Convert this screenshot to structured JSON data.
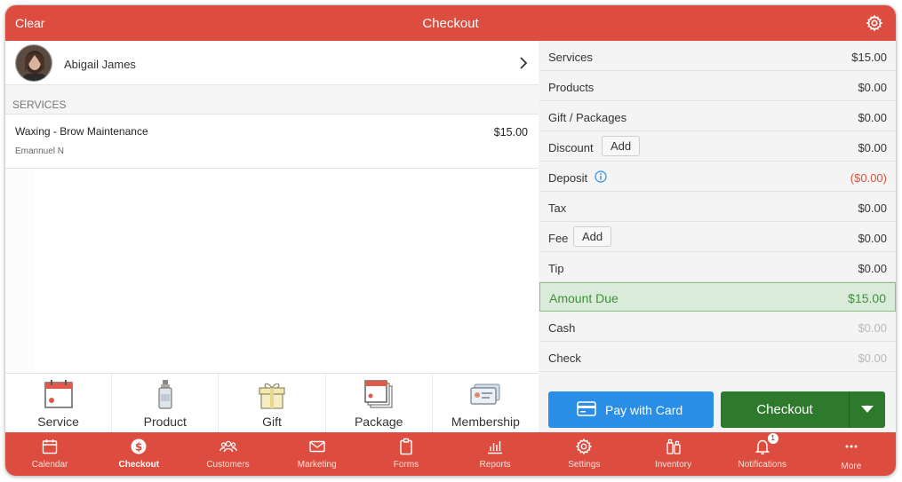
{
  "header": {
    "clear_label": "Clear",
    "title": "Checkout",
    "settings_icon": "gear-icon"
  },
  "client": {
    "name": "Abigail James"
  },
  "services_section": {
    "heading": "SERVICES",
    "items": [
      {
        "name": "Waxing - Brow Maintenance",
        "staff": "Emannuel N",
        "price": "$15.00"
      }
    ]
  },
  "quick_add": [
    {
      "label": "Service",
      "icon": "calendar-icon"
    },
    {
      "label": "Product",
      "icon": "bottle-icon"
    },
    {
      "label": "Gift",
      "icon": "gift-icon"
    },
    {
      "label": "Package",
      "icon": "calendar-stack-icon"
    },
    {
      "label": "Membership",
      "icon": "membership-card-icon"
    }
  ],
  "summary": {
    "services": {
      "label": "Services",
      "value": "$15.00"
    },
    "products": {
      "label": "Products",
      "value": "$0.00"
    },
    "gift_packages": {
      "label": "Gift / Packages",
      "value": "$0.00"
    },
    "discount": {
      "label": "Discount",
      "add_label": "Add",
      "value": "$0.00"
    },
    "deposit": {
      "label": "Deposit",
      "value": "($0.00)"
    },
    "tax": {
      "label": "Tax",
      "value": "$0.00"
    },
    "fee": {
      "label": "Fee",
      "add_label": "Add",
      "value": "$0.00"
    },
    "tip": {
      "label": "Tip",
      "value": "$0.00"
    },
    "amount_due": {
      "label": "Amount Due",
      "value": "$15.00"
    },
    "cash": {
      "label": "Cash",
      "value": "$0.00"
    },
    "check": {
      "label": "Check",
      "value": "$0.00"
    }
  },
  "actions": {
    "pay_with_card": "Pay with Card",
    "checkout": "Checkout"
  },
  "nav": [
    {
      "label": "Calendar",
      "icon": "calendar-icon",
      "active": false
    },
    {
      "label": "Checkout",
      "icon": "dollar-icon",
      "active": true
    },
    {
      "label": "Customers",
      "icon": "people-icon",
      "active": false
    },
    {
      "label": "Marketing",
      "icon": "envelope-icon",
      "active": false
    },
    {
      "label": "Forms",
      "icon": "clipboard-icon",
      "active": false
    },
    {
      "label": "Reports",
      "icon": "bar-chart-icon",
      "active": false
    },
    {
      "label": "Settings",
      "icon": "gear-icon",
      "active": false
    },
    {
      "label": "Inventory",
      "icon": "bottles-icon",
      "active": false
    },
    {
      "label": "Notifications",
      "icon": "bell-icon",
      "active": false,
      "badge": "1"
    },
    {
      "label": "More",
      "icon": "ellipsis-icon",
      "active": false
    }
  ],
  "colors": {
    "brand": "#dc4c3f",
    "pay_card": "#2b8ee6",
    "checkout": "#2e7a2c",
    "amount_due_bg": "#dbebd9",
    "deposit_red": "#d2553f"
  }
}
